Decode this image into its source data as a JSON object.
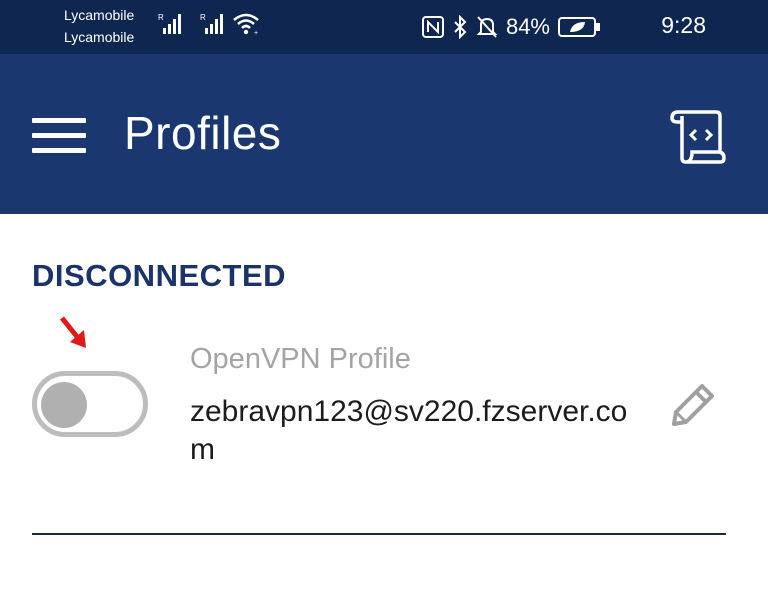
{
  "status_bar": {
    "carrier_1": "Lycamobile",
    "carrier_2": "Lycamobile",
    "battery_percent": "84%",
    "time": "9:28",
    "icons": [
      "signal-roaming-icon",
      "signal-roaming-icon",
      "wifi-icon",
      "nfc-icon",
      "bluetooth-icon",
      "mute-icon",
      "battery-saver-icon"
    ]
  },
  "app_bar": {
    "title": "Profiles",
    "menu_icon": "hamburger-menu-icon",
    "log_icon": "log-scroll-icon"
  },
  "section": {
    "heading": "DISCONNECTED"
  },
  "profile": {
    "name": "OpenVPN Profile",
    "server": "zebravpn123@sv220.fzserver.com",
    "connected": false,
    "edit_icon": "pencil-icon"
  },
  "colors": {
    "status_bar_bg": "#0f2650",
    "app_bar_bg": "#1a3770",
    "heading": "#1b3368",
    "toggle_off": "#b0b0b0",
    "annotation_arrow": "#e01818"
  }
}
